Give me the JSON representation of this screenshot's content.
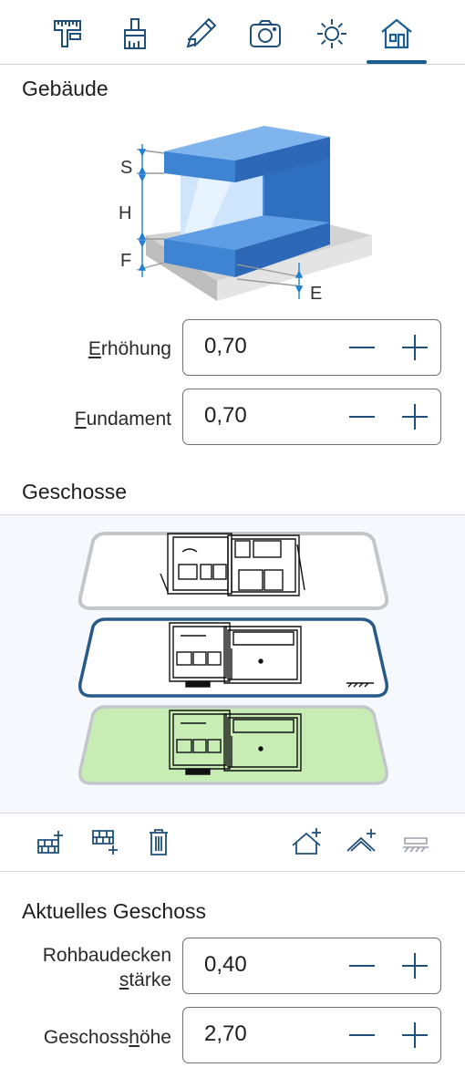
{
  "toolbar": {
    "tools": [
      {
        "icon": "measure-icon"
      },
      {
        "icon": "brush-icon"
      },
      {
        "icon": "pencil-icon"
      },
      {
        "icon": "camera-icon"
      },
      {
        "icon": "sun-icon"
      },
      {
        "icon": "house-icon",
        "active": true
      }
    ]
  },
  "building": {
    "title": "Gebäude",
    "diagram_labels": {
      "s": "S",
      "h": "H",
      "f": "F",
      "e": "E"
    },
    "elevation": {
      "label_first": "E",
      "label_rest": "rhöhung",
      "value": "0,70"
    },
    "foundation": {
      "label_first": "F",
      "label_rest": "undament",
      "value": "0,70"
    }
  },
  "floors": {
    "title": "Geschosse",
    "items": [
      {
        "state": "upper"
      },
      {
        "state": "selected"
      },
      {
        "state": "ground"
      }
    ]
  },
  "current_floor": {
    "title": "Aktuelles Geschoss",
    "slab": {
      "label_line1": "Rohbaudecken",
      "label_ul": "s",
      "label_line2_rest": "tärke",
      "value": "0,40"
    },
    "height": {
      "label_pre": "Geschoss",
      "label_ul": "h",
      "label_post": "öhe",
      "value": "2,70"
    }
  },
  "colors": {
    "accent": "#1b5e92",
    "icon": "#1f4f7a",
    "ground_floor": "#c7ecb4",
    "building_blue": "#4a8fd8"
  }
}
